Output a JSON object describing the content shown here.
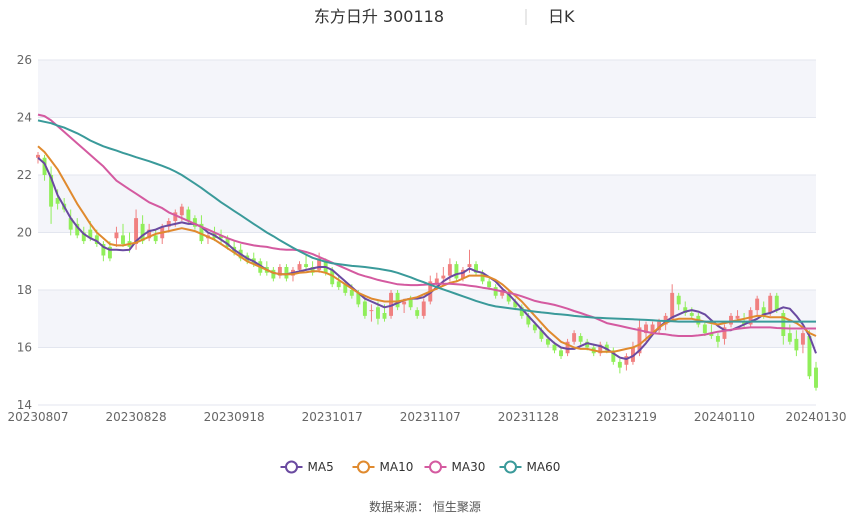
{
  "chart_data": {
    "type": "candlestick",
    "title": "东方日升 300118",
    "period_label": "日K",
    "source_text": "数据来源：  恒生聚源",
    "colors": {
      "up": "#f08080",
      "down": "#90ee5a",
      "background_band": "#f4f5fa",
      "grid": "#e3e6ef",
      "MA5": "#6a4aa0",
      "MA10": "#e08a2e",
      "MA30": "#d45aa0",
      "MA60": "#3a9a9a"
    },
    "y_axis": {
      "min": 14,
      "max": 26,
      "ticks": [
        "14",
        "16",
        "18",
        "20",
        "22",
        "24",
        "26"
      ]
    },
    "x_ticks": [
      {
        "label": "20230807",
        "index": 0
      },
      {
        "label": "20230828",
        "index": 15
      },
      {
        "label": "20230918",
        "index": 30
      },
      {
        "label": "20231017",
        "index": 45
      },
      {
        "label": "20231107",
        "index": 60
      },
      {
        "label": "20231128",
        "index": 75
      },
      {
        "label": "20231219",
        "index": 90
      },
      {
        "label": "20240110",
        "index": 105
      },
      {
        "label": "20240130",
        "index": 119
      }
    ],
    "n_days": 120,
    "candles_ohlc": [
      [
        22.6,
        22.8,
        22.4,
        22.7
      ],
      [
        22.6,
        22.7,
        21.8,
        22.0
      ],
      [
        22.0,
        22.3,
        20.3,
        20.9
      ],
      [
        21.2,
        21.5,
        20.8,
        21.0
      ],
      [
        21.0,
        21.2,
        20.7,
        20.8
      ],
      [
        20.5,
        20.8,
        19.9,
        20.1
      ],
      [
        20.3,
        20.5,
        19.8,
        19.9
      ],
      [
        20.0,
        20.2,
        19.6,
        19.7
      ],
      [
        20.1,
        20.4,
        19.7,
        19.8
      ],
      [
        19.9,
        20.1,
        19.5,
        19.6
      ],
      [
        19.6,
        19.7,
        19.0,
        19.2
      ],
      [
        19.5,
        19.7,
        19.0,
        19.1
      ],
      [
        19.8,
        20.2,
        19.5,
        20.0
      ],
      [
        19.9,
        20.3,
        19.5,
        19.6
      ],
      [
        19.7,
        20.0,
        19.3,
        19.5
      ],
      [
        19.6,
        20.8,
        19.4,
        20.5
      ],
      [
        20.3,
        20.6,
        19.6,
        19.7
      ],
      [
        19.8,
        20.3,
        19.7,
        20.1
      ],
      [
        19.9,
        20.1,
        19.6,
        19.7
      ],
      [
        19.8,
        20.3,
        19.6,
        20.2
      ],
      [
        20.2,
        20.5,
        20.0,
        20.4
      ],
      [
        20.4,
        20.8,
        20.2,
        20.7
      ],
      [
        20.6,
        21.0,
        20.4,
        20.9
      ],
      [
        20.8,
        20.9,
        20.3,
        20.4
      ],
      [
        20.5,
        20.6,
        20.1,
        20.2
      ],
      [
        20.3,
        20.6,
        19.6,
        19.7
      ],
      [
        19.8,
        20.0,
        19.6,
        19.9
      ],
      [
        20.0,
        20.2,
        19.7,
        19.8
      ],
      [
        19.9,
        20.1,
        19.6,
        19.8
      ],
      [
        19.8,
        19.9,
        19.4,
        19.5
      ],
      [
        19.5,
        19.7,
        19.2,
        19.3
      ],
      [
        19.4,
        19.6,
        19.0,
        19.1
      ],
      [
        19.2,
        19.3,
        18.9,
        19.0
      ],
      [
        19.1,
        19.3,
        18.8,
        18.9
      ],
      [
        19.0,
        19.1,
        18.5,
        18.6
      ],
      [
        18.8,
        19.0,
        18.5,
        18.6
      ],
      [
        18.7,
        18.8,
        18.3,
        18.4
      ],
      [
        18.5,
        18.9,
        18.4,
        18.8
      ],
      [
        18.8,
        18.9,
        18.3,
        18.4
      ],
      [
        18.5,
        18.8,
        18.3,
        18.7
      ],
      [
        18.7,
        19.0,
        18.6,
        18.9
      ],
      [
        18.9,
        19.2,
        18.7,
        18.8
      ],
      [
        18.8,
        19.0,
        18.5,
        18.6
      ],
      [
        18.7,
        19.3,
        18.6,
        19.1
      ],
      [
        19.0,
        19.1,
        18.5,
        18.6
      ],
      [
        18.7,
        18.8,
        18.1,
        18.2
      ],
      [
        18.3,
        18.5,
        18.0,
        18.1
      ],
      [
        18.2,
        18.3,
        17.8,
        17.9
      ],
      [
        18.0,
        18.2,
        17.7,
        17.8
      ],
      [
        17.9,
        18.0,
        17.4,
        17.5
      ],
      [
        17.6,
        17.8,
        17.0,
        17.1
      ],
      [
        17.3,
        17.5,
        16.9,
        17.3
      ],
      [
        17.4,
        17.6,
        16.8,
        17.0
      ],
      [
        17.2,
        17.5,
        16.9,
        17.0
      ],
      [
        17.1,
        18.0,
        17.0,
        17.9
      ],
      [
        17.9,
        18.0,
        17.3,
        17.4
      ],
      [
        17.5,
        17.7,
        17.2,
        17.6
      ],
      [
        17.7,
        17.8,
        17.3,
        17.4
      ],
      [
        17.3,
        17.4,
        17.0,
        17.1
      ],
      [
        17.1,
        17.7,
        17.0,
        17.6
      ],
      [
        17.6,
        18.5,
        17.5,
        18.3
      ],
      [
        18.2,
        18.6,
        18.0,
        18.4
      ],
      [
        18.4,
        18.8,
        18.2,
        18.5
      ],
      [
        18.5,
        19.1,
        18.3,
        18.9
      ],
      [
        18.9,
        19.0,
        18.3,
        18.4
      ],
      [
        18.4,
        18.8,
        18.3,
        18.7
      ],
      [
        18.8,
        19.4,
        18.6,
        18.9
      ],
      [
        18.9,
        19.0,
        18.5,
        18.6
      ],
      [
        18.6,
        18.7,
        18.2,
        18.3
      ],
      [
        18.3,
        18.4,
        18.0,
        18.1
      ],
      [
        18.1,
        18.2,
        17.7,
        17.8
      ],
      [
        17.8,
        18.1,
        17.7,
        18.0
      ],
      [
        17.9,
        18.0,
        17.5,
        17.6
      ],
      [
        17.6,
        17.7,
        17.3,
        17.4
      ],
      [
        17.4,
        17.5,
        17.0,
        17.1
      ],
      [
        17.1,
        17.2,
        16.7,
        16.8
      ],
      [
        16.8,
        16.9,
        16.5,
        16.6
      ],
      [
        16.6,
        16.7,
        16.2,
        16.3
      ],
      [
        16.3,
        16.4,
        16.0,
        16.1
      ],
      [
        16.1,
        16.2,
        15.8,
        15.9
      ],
      [
        15.9,
        16.0,
        15.6,
        15.7
      ],
      [
        15.8,
        16.3,
        15.7,
        16.2
      ],
      [
        16.2,
        16.6,
        16.1,
        16.5
      ],
      [
        16.4,
        16.5,
        16.1,
        16.2
      ],
      [
        16.2,
        16.3,
        15.9,
        16.0
      ],
      [
        16.0,
        16.1,
        15.7,
        15.8
      ],
      [
        15.8,
        16.2,
        15.7,
        16.1
      ],
      [
        16.1,
        16.2,
        15.8,
        15.9
      ],
      [
        15.9,
        16.0,
        15.4,
        15.5
      ],
      [
        15.5,
        15.6,
        15.1,
        15.3
      ],
      [
        15.4,
        15.8,
        15.2,
        15.7
      ],
      [
        15.5,
        16.2,
        15.4,
        16.0
      ],
      [
        15.8,
        17.0,
        15.7,
        16.7
      ],
      [
        16.5,
        16.9,
        16.2,
        16.8
      ],
      [
        16.5,
        16.9,
        16.4,
        16.8
      ],
      [
        16.6,
        17.0,
        16.5,
        16.9
      ],
      [
        16.8,
        17.2,
        16.6,
        17.1
      ],
      [
        17.0,
        18.2,
        16.9,
        17.9
      ],
      [
        17.8,
        17.9,
        17.3,
        17.5
      ],
      [
        17.4,
        17.6,
        17.1,
        17.2
      ],
      [
        17.2,
        17.4,
        17.0,
        17.1
      ],
      [
        17.1,
        17.2,
        16.7,
        16.8
      ],
      [
        16.8,
        16.9,
        16.4,
        16.5
      ],
      [
        16.5,
        16.8,
        16.3,
        16.4
      ],
      [
        16.4,
        16.5,
        16.0,
        16.2
      ],
      [
        16.3,
        16.8,
        16.1,
        16.7
      ],
      [
        16.8,
        17.2,
        16.7,
        17.1
      ],
      [
        17.0,
        17.3,
        16.9,
        17.1
      ],
      [
        16.9,
        17.2,
        16.7,
        16.8
      ],
      [
        16.8,
        17.4,
        16.7,
        17.3
      ],
      [
        17.3,
        17.8,
        17.1,
        17.7
      ],
      [
        17.4,
        17.6,
        17.0,
        17.1
      ],
      [
        17.2,
        17.9,
        17.1,
        17.8
      ],
      [
        17.8,
        17.9,
        17.2,
        17.3
      ],
      [
        17.2,
        17.3,
        16.1,
        16.4
      ],
      [
        16.5,
        16.8,
        16.1,
        16.2
      ],
      [
        16.3,
        16.6,
        15.7,
        15.9
      ],
      [
        16.1,
        16.6,
        15.8,
        16.5
      ],
      [
        16.4,
        16.6,
        14.9,
        15.0
      ],
      [
        15.3,
        15.5,
        14.5,
        14.6
      ]
    ],
    "series": [
      {
        "name": "MA5",
        "values": [
          22.6,
          22.4,
          21.9,
          21.3,
          20.9,
          20.5,
          20.2,
          19.95,
          19.8,
          19.7,
          19.5,
          19.4,
          19.4,
          19.38,
          19.4,
          19.7,
          19.9,
          20.05,
          20.1,
          20.2,
          20.25,
          20.3,
          20.35,
          20.3,
          20.3,
          20.2,
          20.0,
          19.9,
          19.75,
          19.6,
          19.4,
          19.25,
          19.1,
          19.0,
          18.85,
          18.7,
          18.6,
          18.55,
          18.55,
          18.6,
          18.65,
          18.7,
          18.75,
          18.8,
          18.8,
          18.7,
          18.5,
          18.3,
          18.1,
          17.9,
          17.7,
          17.6,
          17.5,
          17.4,
          17.45,
          17.55,
          17.65,
          17.7,
          17.7,
          17.75,
          17.9,
          18.1,
          18.3,
          18.45,
          18.55,
          18.6,
          18.75,
          18.65,
          18.6,
          18.45,
          18.3,
          18.05,
          17.85,
          17.6,
          17.35,
          17.1,
          16.85,
          16.6,
          16.35,
          16.15,
          16.0,
          15.95,
          15.95,
          16.05,
          16.15,
          16.1,
          16.05,
          15.95,
          15.8,
          15.65,
          15.6,
          15.7,
          15.9,
          16.15,
          16.45,
          16.7,
          16.9,
          17.05,
          17.15,
          17.25,
          17.3,
          17.25,
          17.15,
          16.95,
          16.75,
          16.6,
          16.6,
          16.7,
          16.8,
          16.9,
          17.0,
          17.15,
          17.2,
          17.3,
          17.4,
          17.35,
          17.1,
          16.8,
          16.4,
          15.8
        ]
      },
      {
        "name": "MA10",
        "values": [
          23.0,
          22.8,
          22.5,
          22.2,
          21.8,
          21.4,
          21.0,
          20.65,
          20.3,
          20.0,
          19.8,
          19.6,
          19.55,
          19.55,
          19.6,
          19.65,
          19.75,
          19.85,
          19.95,
          20.0,
          20.05,
          20.1,
          20.15,
          20.1,
          20.05,
          19.95,
          19.85,
          19.75,
          19.6,
          19.45,
          19.3,
          19.15,
          19.0,
          18.9,
          18.8,
          18.7,
          18.6,
          18.55,
          18.55,
          18.55,
          18.6,
          18.62,
          18.65,
          18.65,
          18.6,
          18.5,
          18.35,
          18.2,
          18.05,
          17.9,
          17.8,
          17.7,
          17.65,
          17.6,
          17.6,
          17.6,
          17.65,
          17.7,
          17.75,
          17.85,
          17.95,
          18.05,
          18.15,
          18.25,
          18.3,
          18.4,
          18.5,
          18.5,
          18.5,
          18.45,
          18.35,
          18.2,
          18.0,
          17.8,
          17.6,
          17.35,
          17.1,
          16.85,
          16.6,
          16.4,
          16.2,
          16.1,
          16.0,
          15.95,
          15.95,
          15.9,
          15.85,
          15.85,
          15.85,
          15.9,
          15.95,
          16.0,
          16.1,
          16.3,
          16.5,
          16.7,
          16.85,
          16.95,
          17.0,
          17.0,
          17.0,
          16.95,
          16.9,
          16.85,
          16.8,
          16.85,
          16.9,
          16.95,
          17.0,
          17.05,
          17.1,
          17.1,
          17.05,
          17.05,
          17.05,
          16.95,
          16.85,
          16.7,
          16.5,
          16.4
        ]
      },
      {
        "name": "MA30",
        "values": [
          24.1,
          24.05,
          23.9,
          23.7,
          23.5,
          23.3,
          23.1,
          22.9,
          22.7,
          22.5,
          22.3,
          22.05,
          21.8,
          21.65,
          21.5,
          21.35,
          21.2,
          21.05,
          20.95,
          20.85,
          20.7,
          20.6,
          20.5,
          20.4,
          20.3,
          20.2,
          20.1,
          20.0,
          19.9,
          19.8,
          19.72,
          19.65,
          19.6,
          19.55,
          19.52,
          19.5,
          19.45,
          19.42,
          19.4,
          19.4,
          19.38,
          19.32,
          19.25,
          19.15,
          19.05,
          18.95,
          18.85,
          18.75,
          18.65,
          18.55,
          18.48,
          18.42,
          18.35,
          18.3,
          18.25,
          18.2,
          18.18,
          18.17,
          18.17,
          18.18,
          18.2,
          18.22,
          18.22,
          18.22,
          18.2,
          18.18,
          18.15,
          18.12,
          18.08,
          18.05,
          18.0,
          17.95,
          17.9,
          17.85,
          17.78,
          17.7,
          17.62,
          17.57,
          17.53,
          17.48,
          17.42,
          17.35,
          17.27,
          17.2,
          17.12,
          17.05,
          16.95,
          16.85,
          16.8,
          16.75,
          16.7,
          16.65,
          16.6,
          16.55,
          16.5,
          16.48,
          16.46,
          16.42,
          16.4,
          16.4,
          16.4,
          16.42,
          16.45,
          16.5,
          16.55,
          16.58,
          16.62,
          16.65,
          16.68,
          16.7,
          16.7,
          16.7,
          16.7,
          16.68,
          16.67,
          16.66,
          16.66,
          16.66,
          16.66,
          16.66
        ]
      },
      {
        "name": "MA60",
        "values": [
          23.9,
          23.85,
          23.8,
          23.72,
          23.65,
          23.55,
          23.45,
          23.33,
          23.2,
          23.1,
          23.0,
          22.92,
          22.85,
          22.77,
          22.7,
          22.62,
          22.55,
          22.48,
          22.4,
          22.32,
          22.23,
          22.12,
          22.0,
          21.85,
          21.7,
          21.55,
          21.38,
          21.22,
          21.05,
          20.9,
          20.75,
          20.6,
          20.45,
          20.3,
          20.15,
          20.0,
          19.87,
          19.73,
          19.6,
          19.47,
          19.35,
          19.23,
          19.12,
          19.05,
          18.98,
          18.93,
          18.9,
          18.87,
          18.84,
          18.82,
          18.8,
          18.77,
          18.74,
          18.7,
          18.66,
          18.6,
          18.52,
          18.44,
          18.35,
          18.27,
          18.18,
          18.1,
          18.02,
          17.94,
          17.86,
          17.78,
          17.7,
          17.62,
          17.55,
          17.48,
          17.43,
          17.4,
          17.37,
          17.34,
          17.31,
          17.28,
          17.25,
          17.22,
          17.2,
          17.17,
          17.15,
          17.13,
          17.1,
          17.08,
          17.06,
          17.04,
          17.03,
          17.02,
          17.01,
          17.0,
          16.99,
          16.98,
          16.97,
          16.96,
          16.95,
          16.93,
          16.92,
          16.91,
          16.9,
          16.9,
          16.9,
          16.9,
          16.9,
          16.9,
          16.9,
          16.9,
          16.9,
          16.9,
          16.9,
          16.9,
          16.9,
          16.9,
          16.9,
          16.9,
          16.9,
          16.9,
          16.9,
          16.9,
          16.9,
          16.9
        ]
      }
    ],
    "legend": [
      "MA5",
      "MA10",
      "MA30",
      "MA60"
    ]
  }
}
